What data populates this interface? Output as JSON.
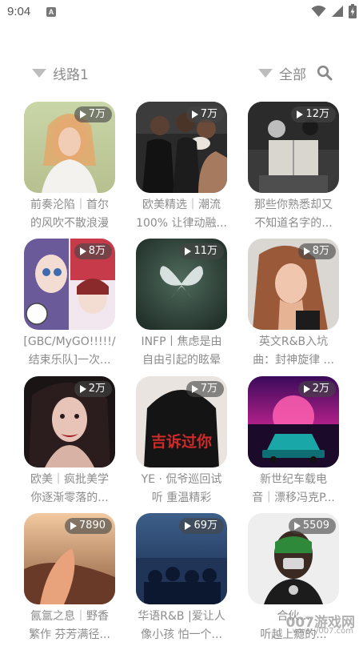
{
  "status_bar": {
    "time": "9:04",
    "app_icon": "A"
  },
  "filter_bar": {
    "route_label": "线路1",
    "category_label": "全部",
    "search_icon": "search-icon",
    "dropdown_color": "#bdbdbd"
  },
  "playlists": [
    {
      "plays": "7万",
      "line1": "前奏沦陷｜首尔",
      "line2": "的风吹不散浪漫"
    },
    {
      "plays": "7万",
      "line1": "欧美精选｜潮流",
      "line2": "100% 让律动融..."
    },
    {
      "plays": "12万",
      "line1": "那些你熟悉却又",
      "line2": "不知道名字的..."
    },
    {
      "plays": "8万",
      "line1": "[GBC/MyGO!!!!!/",
      "line2": "结束乐队]一次..."
    },
    {
      "plays": "11万",
      "line1": "INFP丨焦虑是由",
      "line2": "自由引起的眩晕"
    },
    {
      "plays": "8万",
      "line1": "英文R&B入坑",
      "line2": "曲：封神旋律 ..."
    },
    {
      "plays": "2万",
      "line1": "欧美｜疯批美学",
      "line2": "你逐渐零落的..."
    },
    {
      "plays": "7万",
      "line1": "YE · 侃爷巡回试",
      "line2": "听 重温精彩"
    },
    {
      "plays": "2万",
      "line1": "新世纪车载电",
      "line2": "音｜漂移冯克P..."
    },
    {
      "plays": "7890",
      "line1": "氤氲之息｜野香",
      "line2": "繁作 芬芳满径..."
    },
    {
      "plays": "69万",
      "line1": "华语R&B |爱让人",
      "line2": "像小孩 怕一个..."
    },
    {
      "plays": "5509",
      "line1": "合伙...",
      "line2": "听越上瘾的..."
    }
  ],
  "cover_art": [
    {
      "text": ""
    },
    {
      "text": ""
    },
    {
      "text": ""
    },
    {
      "text": ""
    },
    {
      "text": ""
    },
    {
      "text": ""
    },
    {
      "text": ""
    },
    {
      "text": "吉诉过你"
    },
    {
      "text": ""
    },
    {
      "text": ""
    },
    {
      "text": ""
    },
    {
      "text": ""
    }
  ],
  "watermark": {
    "text": "007游戏网",
    "url": "www.y007.com"
  }
}
